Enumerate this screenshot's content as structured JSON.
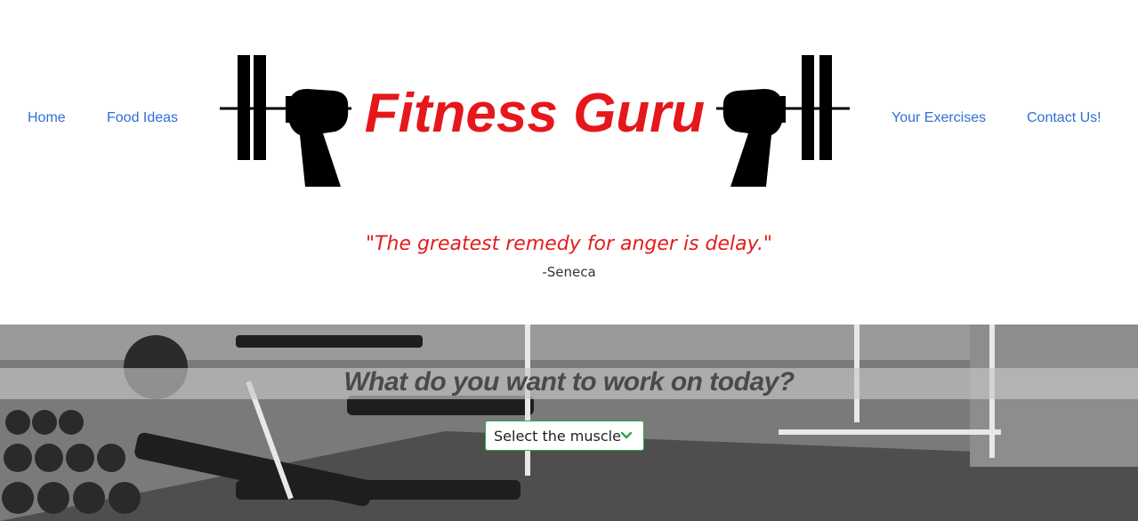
{
  "nav": {
    "home": "Home",
    "food_ideas": "Food Ideas",
    "your_exercises": "Your Exercises",
    "contact_us": "Contact Us!"
  },
  "logo": {
    "text": "Fitness Guru",
    "text_color": "#e5171b"
  },
  "quote": {
    "text": "\"The greatest remedy for anger is delay.\"",
    "author": "-Seneca"
  },
  "hero": {
    "heading": "What do you want to work on today?",
    "select": {
      "value": "Select the muscle",
      "icon": "chevron-down-icon"
    }
  },
  "colors": {
    "link": "#2f6fd6",
    "quote": "#e31d1d",
    "select_border": "#2aa84a"
  }
}
